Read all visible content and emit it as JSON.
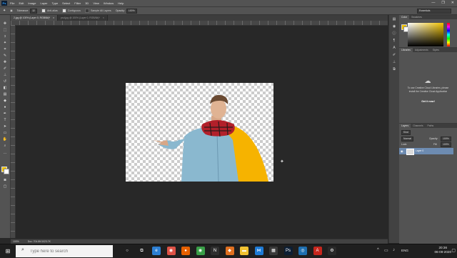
{
  "app": {
    "logo": "Ps"
  },
  "menu": [
    "File",
    "Edit",
    "Image",
    "Layer",
    "Type",
    "Select",
    "Filter",
    "3D",
    "View",
    "Window",
    "Help"
  ],
  "window_controls": [
    "—",
    "❐",
    "✕"
  ],
  "options": {
    "tolerance_label": "Tolerance:",
    "tolerance_value": "32",
    "anti_alias": "Anti-alias",
    "contiguous": "Contiguous",
    "sample_all": "Sample All Layers",
    "opacity_label": "Opacity:",
    "opacity_value": "100%",
    "workspace": "Essentials"
  },
  "tabs": [
    {
      "label": "2.jpg @ 100% (Layer 0, RGB/8#)*",
      "active": true
    },
    {
      "label": "psd.jpg @ 100% (Layer 0, RGB/8#)*",
      "active": false
    }
  ],
  "status": {
    "zoom": "100%",
    "doc": "Doc: 704.8K/1023.7K"
  },
  "color_panel": {
    "tabs": [
      "Color",
      "Swatches"
    ],
    "fg": "#f2c300",
    "bg": "#ffffff"
  },
  "libraries": {
    "tabs": [
      "Libraries",
      "Adjustments",
      "Styles"
    ],
    "message": "To use Creative Cloud Libraries, please install the Creative Cloud Application",
    "link": "Get it now!"
  },
  "layers": {
    "tabs": [
      "Layers",
      "Channels",
      "Paths"
    ],
    "kind": "Kind",
    "blend": "Normal",
    "opacity_label": "Opacity:",
    "opacity_value": "100%",
    "lock_label": "Lock:",
    "fill_label": "Fill:",
    "fill_value": "100%",
    "items": [
      {
        "name": "Layer 0"
      }
    ]
  },
  "taskbar": {
    "search_placeholder": "Type here to search",
    "lang": "ENG",
    "time": "20:36",
    "date": "06-09-2020",
    "icons": [
      {
        "name": "cortana-icon",
        "glyph": "○",
        "color": "#1f1f1f"
      },
      {
        "name": "task-view-icon",
        "glyph": "⧉",
        "color": "#1f1f1f"
      },
      {
        "name": "edge-icon",
        "glyph": "e",
        "color": "#2d7fd3"
      },
      {
        "name": "chrome-icon",
        "glyph": "◉",
        "color": "#de5246"
      },
      {
        "name": "firefox-icon",
        "glyph": "●",
        "color": "#e66000"
      },
      {
        "name": "chrome-alt-icon",
        "glyph": "◉",
        "color": "#3a9f48"
      },
      {
        "name": "notion-icon",
        "glyph": "N",
        "color": "#2f2f2f"
      },
      {
        "name": "app-orange-icon",
        "glyph": "◆",
        "color": "#e07020"
      },
      {
        "name": "file-explorer-icon",
        "glyph": "▬",
        "color": "#f1c232"
      },
      {
        "name": "vscode-icon",
        "glyph": "⋈",
        "color": "#1e7bd6"
      },
      {
        "name": "store-icon",
        "glyph": "▦",
        "color": "#3a3a3a"
      },
      {
        "name": "photoshop-icon",
        "glyph": "Ps",
        "color": "#0d1e33"
      },
      {
        "name": "camera-icon",
        "glyph": "◎",
        "color": "#1f6fb0"
      },
      {
        "name": "acrobat-icon",
        "glyph": "A",
        "color": "#c7261d"
      },
      {
        "name": "settings-icon",
        "glyph": "⚙",
        "color": "#2a2a2a"
      }
    ]
  }
}
